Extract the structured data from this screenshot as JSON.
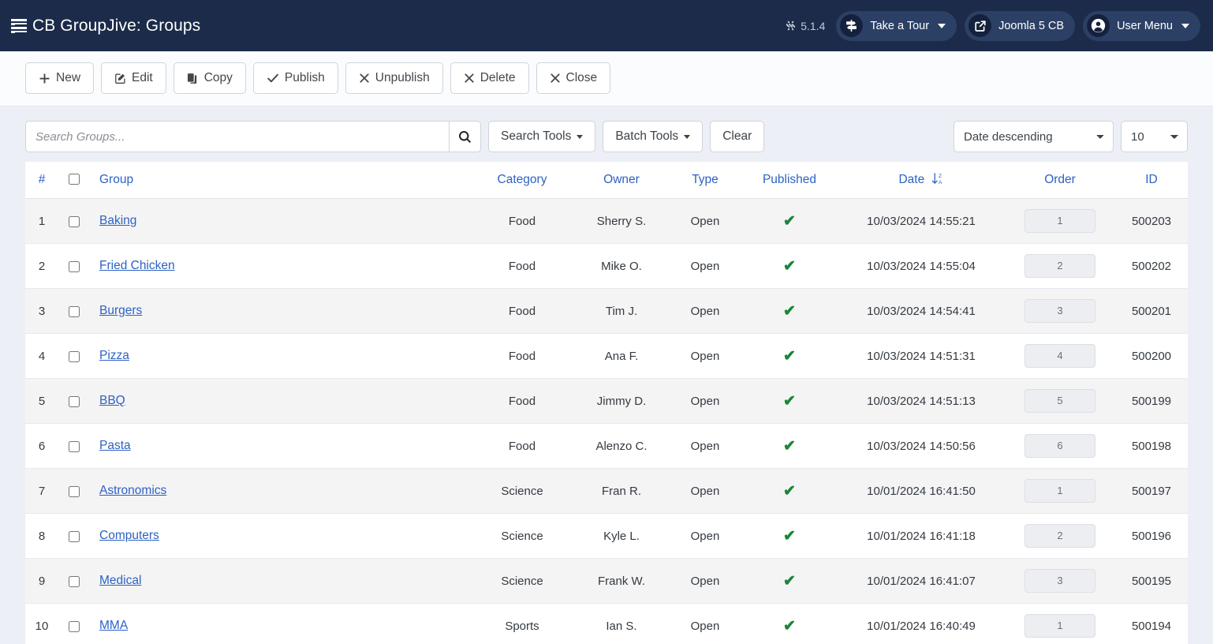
{
  "header": {
    "title": "CB GroupJive: Groups",
    "title_icon": "list-icon",
    "version": "5.1.4",
    "version_icon": "joomla-logo-icon",
    "tour_label": "Take a Tour",
    "tour_icon": "signpost-icon",
    "site_label": "Joomla 5 CB",
    "site_icon": "external-link-icon",
    "user_label": "User Menu",
    "user_icon": "user-circle-icon"
  },
  "toolbar": {
    "buttons": [
      {
        "label": "New",
        "icon": "plus-icon"
      },
      {
        "label": "Edit",
        "icon": "pencil-square-icon"
      },
      {
        "label": "Copy",
        "icon": "copy-icon"
      },
      {
        "label": "Publish",
        "icon": "check-icon"
      },
      {
        "label": "Unpublish",
        "icon": "x-icon"
      },
      {
        "label": "Delete",
        "icon": "x-icon"
      },
      {
        "label": "Close",
        "icon": "x-icon"
      }
    ]
  },
  "filters": {
    "search_placeholder": "Search Groups...",
    "search_value": "",
    "search_button_icon": "search-icon",
    "search_tools_label": "Search Tools",
    "batch_tools_label": "Batch Tools",
    "clear_label": "Clear",
    "sort_selected": "Date descending",
    "sort_options": [
      "Date descending"
    ],
    "limit_selected": "10",
    "limit_options": [
      "10"
    ]
  },
  "table": {
    "columns": {
      "num": "#",
      "group": "Group",
      "category": "Category",
      "owner": "Owner",
      "type": "Type",
      "published": "Published",
      "date": "Date",
      "order": "Order",
      "id": "ID"
    },
    "sort_indicator": {
      "column": "date",
      "icon": "sort-alpha-down-alt-icon",
      "top": "Z",
      "bottom": "A"
    },
    "select_all_checkbox": false,
    "published_mark": "✔",
    "rows": [
      {
        "num": "1",
        "group": "Baking",
        "category": "Food",
        "owner": "Sherry S.",
        "type": "Open",
        "published": true,
        "date": "10/03/2024 14:55:21",
        "order": "1",
        "id": "500203"
      },
      {
        "num": "2",
        "group": "Fried Chicken",
        "category": "Food",
        "owner": "Mike O.",
        "type": "Open",
        "published": true,
        "date": "10/03/2024 14:55:04",
        "order": "2",
        "id": "500202"
      },
      {
        "num": "3",
        "group": "Burgers",
        "category": "Food",
        "owner": "Tim J.",
        "type": "Open",
        "published": true,
        "date": "10/03/2024 14:54:41",
        "order": "3",
        "id": "500201"
      },
      {
        "num": "4",
        "group": "Pizza",
        "category": "Food",
        "owner": "Ana F.",
        "type": "Open",
        "published": true,
        "date": "10/03/2024 14:51:31",
        "order": "4",
        "id": "500200"
      },
      {
        "num": "5",
        "group": "BBQ",
        "category": "Food",
        "owner": "Jimmy D.",
        "type": "Open",
        "published": true,
        "date": "10/03/2024 14:51:13",
        "order": "5",
        "id": "500199"
      },
      {
        "num": "6",
        "group": "Pasta",
        "category": "Food",
        "owner": "Alenzo C.",
        "type": "Open",
        "published": true,
        "date": "10/03/2024 14:50:56",
        "order": "6",
        "id": "500198"
      },
      {
        "num": "7",
        "group": "Astronomics",
        "category": "Science",
        "owner": "Fran R.",
        "type": "Open",
        "published": true,
        "date": "10/01/2024 16:41:50",
        "order": "1",
        "id": "500197"
      },
      {
        "num": "8",
        "group": "Computers",
        "category": "Science",
        "owner": "Kyle L.",
        "type": "Open",
        "published": true,
        "date": "10/01/2024 16:41:18",
        "order": "2",
        "id": "500196"
      },
      {
        "num": "9",
        "group": "Medical",
        "category": "Science",
        "owner": "Frank W.",
        "type": "Open",
        "published": true,
        "date": "10/01/2024 16:41:07",
        "order": "3",
        "id": "500195"
      },
      {
        "num": "10",
        "group": "MMA",
        "category": "Sports",
        "owner": "Ian S.",
        "type": "Open",
        "published": true,
        "date": "10/01/2024 16:40:49",
        "order": "1",
        "id": "500194"
      }
    ]
  },
  "colors": {
    "header_bg": "#1b2b49",
    "pill_bg": "#2c4066",
    "link": "#2d62c4",
    "published_green": "#1a8537",
    "page_bg": "#eceff5"
  }
}
